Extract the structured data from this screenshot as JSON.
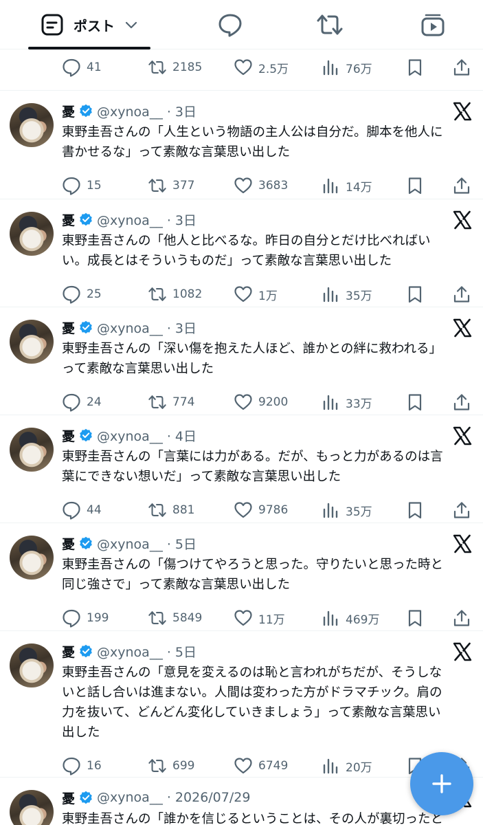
{
  "tabs": {
    "posts_label": "ポスト"
  },
  "top_actions": {
    "replies": "41",
    "reposts": "2185",
    "likes": "2.5万",
    "views": "76万"
  },
  "tweets": [
    {
      "name": "憂",
      "handle": "@xynoa__ · 3日",
      "text": "東野圭吾さんの「人生という物語の主人公は自分だ。脚本を他人に\n書かせるな」って素敵な言葉思い出した",
      "replies": "15",
      "reposts": "377",
      "likes": "3683",
      "views": "14万"
    },
    {
      "name": "憂",
      "handle": "@xynoa__ · 3日",
      "text": "東野圭吾さんの「他人と比べるな。昨日の自分とだけ比べればい\nい。成長とはそういうものだ」って素敵な言葉思い出した",
      "replies": "25",
      "reposts": "1082",
      "likes": "1万",
      "views": "35万"
    },
    {
      "name": "憂",
      "handle": "@xynoa__ · 3日",
      "text": "東野圭吾さんの「深い傷を抱えた人ほど、誰かとの絆に救われる」\nって素敵な言葉思い出した",
      "replies": "24",
      "reposts": "774",
      "likes": "9200",
      "views": "33万"
    },
    {
      "name": "憂",
      "handle": "@xynoa__ · 4日",
      "text": "東野圭吾さんの「言葉には力がある。だが、もっと力があるのは言\n葉にできない想いだ」って素敵な言葉思い出した",
      "replies": "44",
      "reposts": "881",
      "likes": "9786",
      "views": "35万"
    },
    {
      "name": "憂",
      "handle": "@xynoa__ · 5日",
      "text": "東野圭吾さんの「傷つけてやろうと思った。守りたいと思った時と\n同じ強さで」って素敵な言葉思い出した",
      "replies": "199",
      "reposts": "5849",
      "likes": "11万",
      "views": "469万"
    },
    {
      "name": "憂",
      "handle": "@xynoa__ · 5日",
      "text": "東野圭吾さんの「意見を変えるのは恥と言われがちだが、そうしな\nいと話し合いは進まない。人間は変わった方がドラマチック。肩の\n力を抜いて、どんどん変化していきましょう」って素敵な言葉思い\n出した",
      "replies": "16",
      "reposts": "699",
      "likes": "6749",
      "views": "20万"
    },
    {
      "name": "憂",
      "handle": "@xynoa__ · 2026/07/29",
      "text": "東野圭吾さんの「誰かを信じるということは、その人が裏切ったと",
      "replies": "",
      "reposts": "",
      "likes": "",
      "views": ""
    }
  ],
  "colors": {
    "accent": "#1d9bf0",
    "fab": "#4a99e9",
    "muted": "#536471",
    "text": "#0f1419"
  }
}
